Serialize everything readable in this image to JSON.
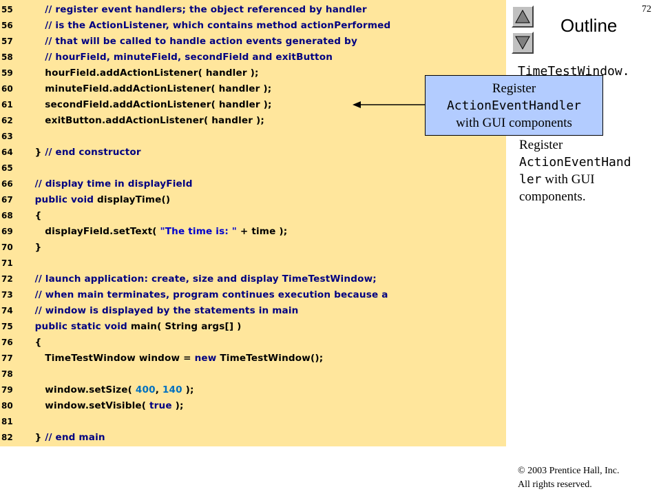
{
  "slide_number": "72",
  "outline_title": "Outline",
  "file_name": "TimeTestWindow.",
  "navigation": {
    "up_icon": "triangle-up-icon",
    "down_icon": "triangle-down-icon"
  },
  "callout": {
    "line_1": "Register",
    "line_2": "ActionEventHandler",
    "line_3": "with GUI components"
  },
  "side_note": {
    "line_1": "Register",
    "line_2": "ActionEventHand",
    "line_3": "ler",
    "line_4": " with GUI",
    "line_5": "components."
  },
  "copyright": {
    "line_1": "© 2003 Prentice Hall, Inc.",
    "line_2": "All rights reserved."
  },
  "colors": {
    "code_background": "#ffe69c",
    "callout_background": "#b3ccff",
    "comment_and_keyword": "#000080",
    "string_literal": "#0000cc",
    "number_literal": "#0070c0"
  },
  "code_lines": [
    {
      "num": "55",
      "tokens": [
        {
          "t": "      "
        },
        {
          "t": "// register event handlers; the object referenced by handler",
          "k": "comment"
        }
      ]
    },
    {
      "num": "56",
      "tokens": [
        {
          "t": "      "
        },
        {
          "t": "// is the ActionListener, which contains method actionPerformed",
          "k": "comment"
        }
      ]
    },
    {
      "num": "57",
      "tokens": [
        {
          "t": "      "
        },
        {
          "t": "// that will be called to handle action events generated by",
          "k": "comment"
        }
      ]
    },
    {
      "num": "58",
      "tokens": [
        {
          "t": "      "
        },
        {
          "t": "// hourField, minuteField, secondField and exitButton",
          "k": "comment"
        }
      ]
    },
    {
      "num": "59",
      "tokens": [
        {
          "t": "      hourField.addActionListener( handler );"
        }
      ]
    },
    {
      "num": "60",
      "tokens": [
        {
          "t": "      minuteField.addActionListener( handler );"
        }
      ]
    },
    {
      "num": "61",
      "tokens": [
        {
          "t": "      secondField.addActionListener( handler );"
        }
      ]
    },
    {
      "num": "62",
      "tokens": [
        {
          "t": "      exitButton.addActionListener( handler );"
        }
      ]
    },
    {
      "num": "63",
      "tokens": []
    },
    {
      "num": "64",
      "tokens": [
        {
          "t": "   } "
        },
        {
          "t": "// end constructor",
          "k": "comment"
        }
      ]
    },
    {
      "num": "65",
      "tokens": []
    },
    {
      "num": "66",
      "tokens": [
        {
          "t": "   "
        },
        {
          "t": "// display time in displayField",
          "k": "comment"
        }
      ]
    },
    {
      "num": "67",
      "tokens": [
        {
          "t": "   "
        },
        {
          "t": "public",
          "k": "keyword"
        },
        {
          "t": " "
        },
        {
          "t": "void",
          "k": "keyword"
        },
        {
          "t": " displayTime()"
        }
      ]
    },
    {
      "num": "68",
      "tokens": [
        {
          "t": "   {"
        }
      ]
    },
    {
      "num": "69",
      "tokens": [
        {
          "t": "      displayField.setText( "
        },
        {
          "t": "\"The time is: \"",
          "k": "string"
        },
        {
          "t": " + time );"
        }
      ]
    },
    {
      "num": "70",
      "tokens": [
        {
          "t": "   }"
        }
      ]
    },
    {
      "num": "71",
      "tokens": []
    },
    {
      "num": "72",
      "tokens": [
        {
          "t": "   "
        },
        {
          "t": "// launch application: create, size and display TimeTestWindow;",
          "k": "comment"
        }
      ]
    },
    {
      "num": "73",
      "tokens": [
        {
          "t": "   "
        },
        {
          "t": "// when main terminates, program continues execution because a",
          "k": "comment"
        }
      ]
    },
    {
      "num": "74",
      "tokens": [
        {
          "t": "   "
        },
        {
          "t": "// window is displayed by the statements in main",
          "k": "comment"
        }
      ]
    },
    {
      "num": "75",
      "tokens": [
        {
          "t": "   "
        },
        {
          "t": "public",
          "k": "keyword"
        },
        {
          "t": " "
        },
        {
          "t": "static",
          "k": "keyword"
        },
        {
          "t": " "
        },
        {
          "t": "void",
          "k": "keyword"
        },
        {
          "t": " main( String args[] )"
        }
      ]
    },
    {
      "num": "76",
      "tokens": [
        {
          "t": "   {"
        }
      ]
    },
    {
      "num": "77",
      "tokens": [
        {
          "t": "      TimeTestWindow window = "
        },
        {
          "t": "new",
          "k": "keyword"
        },
        {
          "t": " TimeTestWindow();"
        }
      ]
    },
    {
      "num": "78",
      "tokens": []
    },
    {
      "num": "79",
      "tokens": [
        {
          "t": "      window.setSize( "
        },
        {
          "t": "400",
          "k": "number"
        },
        {
          "t": ", "
        },
        {
          "t": "140",
          "k": "number"
        },
        {
          "t": " );"
        }
      ]
    },
    {
      "num": "80",
      "tokens": [
        {
          "t": "      window.setVisible( "
        },
        {
          "t": "true",
          "k": "keyword"
        },
        {
          "t": " );"
        }
      ]
    },
    {
      "num": "81",
      "tokens": []
    },
    {
      "num": "82",
      "tokens": [
        {
          "t": "   } "
        },
        {
          "t": "// end main",
          "k": "comment"
        }
      ]
    }
  ]
}
